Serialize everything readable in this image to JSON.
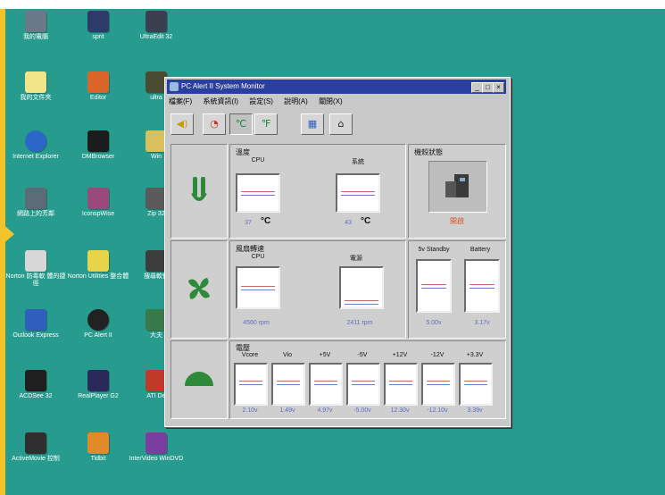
{
  "desktop": {
    "icons": [
      {
        "label": "我的電腦",
        "name": "my-computer"
      },
      {
        "label": "sprit",
        "name": "sprit"
      },
      {
        "label": "UltraEdit 32",
        "name": "ultraedit"
      },
      {
        "label": "我的文件夾",
        "name": "my-documents"
      },
      {
        "label": "Editor",
        "name": "editor"
      },
      {
        "label": "ultra",
        "name": "ultra2"
      },
      {
        "label": "Internet Explorer",
        "name": "internet-explorer"
      },
      {
        "label": "DMBrowser",
        "name": "dmbrowser"
      },
      {
        "label": "Win",
        "name": "win"
      },
      {
        "label": "網路上的芳鄰",
        "name": "network-neighborhood"
      },
      {
        "label": "IconspWise",
        "name": "iconspwise"
      },
      {
        "label": "Zip 32",
        "name": "zip"
      },
      {
        "label": "Norton 防毒軟 體的捷徑",
        "name": "norton-antivirus"
      },
      {
        "label": "Norton Utilities 整合體",
        "name": "norton-utilities"
      },
      {
        "label": "搜尋軟件",
        "name": "search-software"
      },
      {
        "label": "Outlook Express",
        "name": "outlook-express"
      },
      {
        "label": "PC Alert II",
        "name": "pc-alert"
      },
      {
        "label": "大夫",
        "name": "dafu"
      },
      {
        "label": "ACDSee 32",
        "name": "acdsee"
      },
      {
        "label": "RealPlayer G2",
        "name": "realplayer"
      },
      {
        "label": "ATI De",
        "name": "ati"
      },
      {
        "label": "ActiveMovie 控制",
        "name": "activemovie"
      },
      {
        "label": "Tidbit",
        "name": "tidbit"
      },
      {
        "label": "InterVideo WinDVD",
        "name": "windvd"
      }
    ]
  },
  "window": {
    "title": "PC Alert II System Monitor",
    "menu": [
      "檔案(F)",
      "系統資訊(I)",
      "設定(S)",
      "說明(A)",
      "關閉(X)"
    ],
    "tools": [
      {
        "icon": "speaker-icon",
        "glyph": "◀)"
      },
      {
        "icon": "clock-icon",
        "glyph": "◔"
      },
      {
        "icon": "celsius-icon",
        "glyph": "℃"
      },
      {
        "icon": "fahrenheit-icon",
        "glyph": "℉"
      },
      {
        "icon": "chip-icon",
        "glyph": "▦"
      },
      {
        "icon": "home-icon",
        "glyph": "⌂"
      }
    ],
    "temp": {
      "title": "溫度",
      "cpu_label": "CPU",
      "sys_label": "系統",
      "cpu_value": "37",
      "sys_value": "43",
      "unit": "°C"
    },
    "chassis": {
      "title": "機殼狀態",
      "status": "開啟"
    },
    "fan": {
      "title": "風扇轉速",
      "cpu_label": "CPU",
      "psu_label": "電源",
      "cpu_value": "4560 rpm",
      "psu_value": "2411 rpm"
    },
    "standby": {
      "labels": [
        "5v Standby",
        "Battery"
      ],
      "values": [
        "5.00v",
        "3.17v"
      ]
    },
    "voltage": {
      "title": "電壓",
      "labels": [
        "Vcore",
        "Vio",
        "+5V",
        "-5V",
        "+12V",
        "-12V",
        "+3.3V"
      ],
      "values": [
        "2.10v",
        "1.49v",
        "4.97v",
        "-5.00v",
        "12.30v",
        "-12.10v",
        "3.39v"
      ]
    }
  },
  "colors": {
    "desktop": "#279c8e",
    "titlebar": "#2b3fa0",
    "chassis_status": "#e0502a",
    "readout": "#5e6ec2"
  }
}
